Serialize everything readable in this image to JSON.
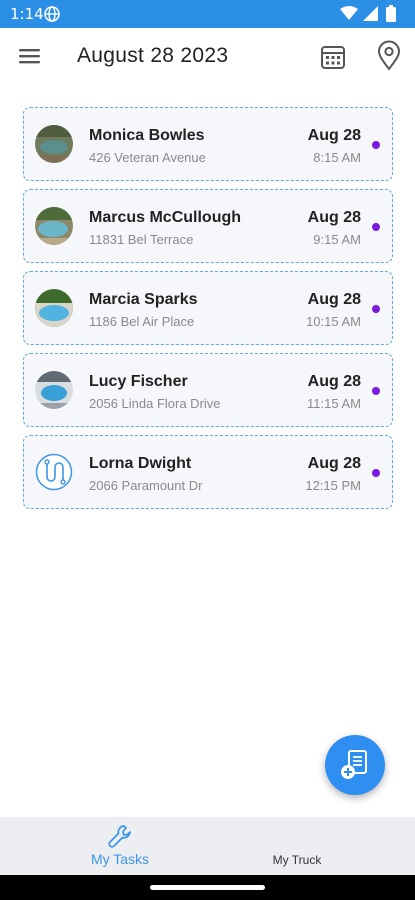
{
  "status_bar": {
    "time": "1:14",
    "icons": [
      "globe-icon",
      "wifi-icon",
      "signal-icon",
      "battery-icon"
    ]
  },
  "app_bar": {
    "title": "August 28 2023",
    "icons": [
      "hamburger-menu-icon",
      "calendar-icon",
      "location-pin-icon"
    ]
  },
  "tasks": [
    {
      "name": "Monica Bowles",
      "address": "426 Veteran Avenue",
      "date": "Aug 28",
      "time": "8:15 AM",
      "avatar": "pool-photo"
    },
    {
      "name": "Marcus McCullough",
      "address": "11831 Bel Terrace",
      "date": "Aug 28",
      "time": "9:15 AM",
      "avatar": "pool-photo"
    },
    {
      "name": "Marcia Sparks",
      "address": "1186 Bel Air Place",
      "date": "Aug 28",
      "time": "10:15 AM",
      "avatar": "pool-photo"
    },
    {
      "name": "Lucy Fischer",
      "address": "2056 Linda Flora Drive",
      "date": "Aug 28",
      "time": "11:15 AM",
      "avatar": "pool-photo"
    },
    {
      "name": "Lorna Dwight",
      "address": "2066 Paramount Dr",
      "date": "Aug 28",
      "time": "12:15 PM",
      "avatar": "route-icon"
    }
  ],
  "fab": {
    "icon": "add-task-icon"
  },
  "bottom_nav": {
    "tasks_label": "My Tasks",
    "truck_label": "My Truck",
    "active": "My Tasks"
  },
  "colors": {
    "primary": "#2b8fe6",
    "dot": "#7a1be0",
    "card_border": "#5aa9e8",
    "card_bg": "#f6f7fb"
  }
}
